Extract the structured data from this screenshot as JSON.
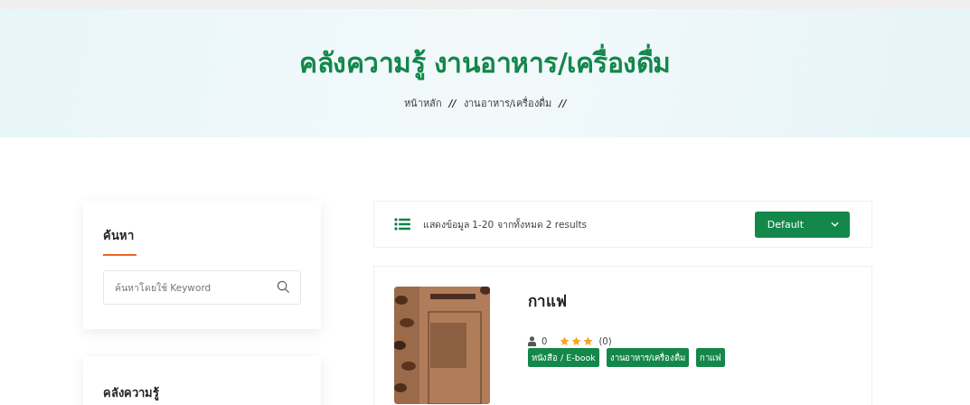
{
  "banner": {
    "title": "คลังความรู้ งานอาหาร/เครื่องดื่ม",
    "breadcrumb": [
      {
        "label": "หน้าหลัก",
        "separator": "//"
      },
      {
        "label": "งานอาหาร/เครื่องดื่ม",
        "separator": "//"
      }
    ]
  },
  "sidebar": {
    "search": {
      "title": "ค้นหา",
      "placeholder": "ค้นหาโดยใช้ Keyword"
    },
    "library": {
      "title": "คลังความรู้"
    }
  },
  "toolbar": {
    "summary": "แสดงข้อมูล 1-20 จากทั้งหมด 2 results",
    "sort": "Default"
  },
  "products": [
    {
      "title": "กาแฟ",
      "views": "0",
      "stars": 3,
      "reviews": "(0)",
      "tags": [
        "หนังสือ / E-book",
        "งานอาหาร/เครื่องดื่ม",
        "กาแฟ"
      ]
    }
  ]
}
